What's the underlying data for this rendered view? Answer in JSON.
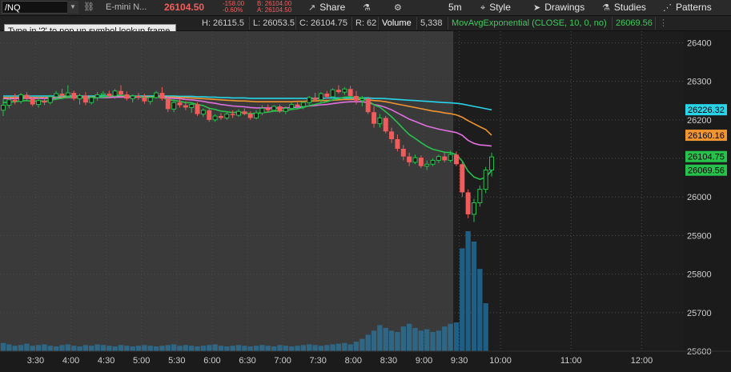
{
  "toolbar": {
    "symbol": "/NQ",
    "description": "E-mini N...",
    "last_price": "26104.50",
    "net_change": "-158.00",
    "pct_change": "-0.60%",
    "bid": "B: 26104.00",
    "ask": "A: 26104.50",
    "share_label": "Share",
    "timeframe": "5m",
    "style_label": "Style",
    "drawings_label": "Drawings",
    "studies_label": "Studies",
    "patterns_label": "Patterns"
  },
  "infobar": {
    "high": "H: 26115.5",
    "low": "L: 26053.5",
    "close": "C: 26104.75",
    "range": "R: 62",
    "volume_label": "Volume",
    "volume_value": "5,338",
    "study": "MovAvgExponential (CLOSE, 10, 0, no)",
    "study_value": "26069.56"
  },
  "tooltip": "Type in '?' to pop up symbol lookup frame.",
  "colors": {
    "up": "#27c24c",
    "down": "#f05b5b",
    "ema_green": "#27c24c",
    "ema_magenta": "#e070e0",
    "ema_orange": "#f09430",
    "ema_cyan": "#28d4e8",
    "ema_yellow": "#d8d040",
    "volume": "#2f6683",
    "volume_current": "#1f5f86"
  },
  "chart_data": {
    "type": "candlestick",
    "xlabel": "",
    "ylabel": "",
    "ylim": [
      25600,
      26430
    ],
    "y_ticks": [
      25600,
      25700,
      25800,
      25900,
      26000,
      26100,
      26200,
      26300,
      26400
    ],
    "x_ticks": [
      "3:30",
      "4:00",
      "4:30",
      "5:00",
      "5:30",
      "6:00",
      "6:30",
      "7:00",
      "7:30",
      "8:00",
      "8:30",
      "9:00",
      "9:30",
      "10:00",
      "11:00",
      "12:00"
    ],
    "x_tick_bars": [
      5.5,
      11.5,
      17.5,
      23.5,
      29.5,
      35.5,
      41.5,
      47.5,
      53.5,
      59.5,
      65.5,
      71.5,
      77.5,
      84.5,
      96.5,
      108.5
    ],
    "bar_count_visible": 114,
    "session_start_bar": 77,
    "candles": [
      [
        26225,
        26255,
        26210,
        26238
      ],
      [
        26238,
        26260,
        26230,
        26252
      ],
      [
        26252,
        26268,
        26240,
        26248
      ],
      [
        26248,
        26270,
        26242,
        26265
      ],
      [
        26265,
        26272,
        26250,
        26255
      ],
      [
        26255,
        26260,
        26235,
        26240
      ],
      [
        26240,
        26258,
        26232,
        26250
      ],
      [
        26250,
        26262,
        26238,
        26245
      ],
      [
        26245,
        26265,
        26240,
        26260
      ],
      [
        26260,
        26275,
        26252,
        26268
      ],
      [
        26268,
        26280,
        26256,
        26262
      ],
      [
        26262,
        26290,
        26258,
        26270
      ],
      [
        26270,
        26276,
        26250,
        26255
      ],
      [
        26255,
        26268,
        26240,
        26263
      ],
      [
        26263,
        26272,
        26238,
        26245
      ],
      [
        26245,
        26262,
        26240,
        26258
      ],
      [
        26258,
        26272,
        26250,
        26265
      ],
      [
        26265,
        26275,
        26255,
        26268
      ],
      [
        26268,
        26276,
        26258,
        26262
      ],
      [
        26262,
        26280,
        26255,
        26275
      ],
      [
        26275,
        26290,
        26260,
        26266
      ],
      [
        26266,
        26274,
        26250,
        26255
      ],
      [
        26255,
        26266,
        26245,
        26262
      ],
      [
        26262,
        26270,
        26252,
        26258
      ],
      [
        26258,
        26268,
        26242,
        26248
      ],
      [
        26248,
        26262,
        26240,
        26258
      ],
      [
        26258,
        26275,
        26255,
        26270
      ],
      [
        26270,
        26285,
        26250,
        26255
      ],
      [
        26255,
        26260,
        26220,
        26228
      ],
      [
        26228,
        26250,
        26220,
        26245
      ],
      [
        26245,
        26255,
        26232,
        26238
      ],
      [
        26238,
        26248,
        26225,
        26232
      ],
      [
        26232,
        26245,
        26218,
        26240
      ],
      [
        26240,
        26246,
        26210,
        26215
      ],
      [
        26215,
        26230,
        26208,
        26225
      ],
      [
        26225,
        26232,
        26195,
        26200
      ],
      [
        26200,
        26215,
        26195,
        26210
      ],
      [
        26210,
        26218,
        26200,
        26205
      ],
      [
        26205,
        26220,
        26200,
        26215
      ],
      [
        26215,
        26225,
        26205,
        26212
      ],
      [
        26212,
        26228,
        26208,
        26222
      ],
      [
        26222,
        26230,
        26212,
        26215
      ],
      [
        26215,
        26222,
        26200,
        26205
      ],
      [
        26205,
        26225,
        26202,
        26218
      ],
      [
        26218,
        26238,
        26212,
        26230
      ],
      [
        26230,
        26240,
        26220,
        26225
      ],
      [
        26225,
        26238,
        26222,
        26235
      ],
      [
        26235,
        26240,
        26218,
        26222
      ],
      [
        26222,
        26235,
        26215,
        26230
      ],
      [
        26230,
        26245,
        26225,
        26240
      ],
      [
        26240,
        26250,
        26230,
        26235
      ],
      [
        26235,
        26248,
        26228,
        26245
      ],
      [
        26245,
        26262,
        26240,
        26258
      ],
      [
        26258,
        26270,
        26248,
        26252
      ],
      [
        26252,
        26272,
        26245,
        26268
      ],
      [
        26268,
        26275,
        26255,
        26260
      ],
      [
        26260,
        26282,
        26255,
        26278
      ],
      [
        26278,
        26290,
        26268,
        26272
      ],
      [
        26272,
        26285,
        26265,
        26280
      ],
      [
        26280,
        26288,
        26258,
        26262
      ],
      [
        26262,
        26275,
        26240,
        26250
      ],
      [
        26250,
        26262,
        26235,
        26255
      ],
      [
        26255,
        26260,
        26215,
        26220
      ],
      [
        26220,
        26235,
        26180,
        26190
      ],
      [
        26190,
        26215,
        26180,
        26205
      ],
      [
        26205,
        26210,
        26165,
        26170
      ],
      [
        26170,
        26180,
        26140,
        26150
      ],
      [
        26150,
        26162,
        26118,
        26125
      ],
      [
        26125,
        26135,
        26095,
        26105
      ],
      [
        26105,
        26115,
        26080,
        26090
      ],
      [
        26090,
        26110,
        26085,
        26102
      ],
      [
        26102,
        26108,
        26075,
        26080
      ],
      [
        26080,
        26095,
        26070,
        26085
      ],
      [
        26085,
        26100,
        26080,
        26095
      ],
      [
        26095,
        26110,
        26088,
        26105
      ],
      [
        26105,
        26115,
        26090,
        26095
      ],
      [
        26095,
        26120,
        26090,
        26110
      ],
      [
        26110,
        26118,
        26080,
        26085
      ],
      [
        26085,
        26090,
        26000,
        26012
      ],
      [
        26012,
        26020,
        25945,
        25955
      ],
      [
        25955,
        25995,
        25935,
        25985
      ],
      [
        25985,
        26030,
        25975,
        26020
      ],
      [
        26020,
        26078,
        26010,
        26070
      ],
      [
        26070,
        26115,
        26053,
        26104
      ]
    ],
    "volume": [
      12,
      10,
      8,
      9,
      11,
      8,
      9,
      10,
      8,
      7,
      9,
      10,
      8,
      7,
      9,
      8,
      10,
      9,
      8,
      7,
      9,
      8,
      7,
      8,
      9,
      8,
      7,
      8,
      9,
      10,
      8,
      9,
      8,
      7,
      8,
      9,
      10,
      8,
      7,
      8,
      9,
      8,
      7,
      8,
      9,
      8,
      7,
      9,
      8,
      7,
      8,
      9,
      10,
      9,
      8,
      9,
      10,
      11,
      12,
      10,
      14,
      18,
      24,
      30,
      38,
      34,
      30,
      28,
      36,
      40,
      34,
      30,
      32,
      28,
      30,
      36,
      40,
      42,
      150,
      175,
      160,
      120,
      70
    ],
    "ema": [
      {
        "period_label": "green",
        "values": [
          26245,
          26246,
          26247,
          26249,
          26250,
          26248,
          26249,
          26248,
          26250,
          26254,
          26256,
          26259,
          26258,
          26259,
          26256,
          26256,
          26258,
          26260,
          26261,
          26264,
          26264,
          26262,
          26262,
          26261,
          26258,
          26258,
          26260,
          26259,
          26252,
          26251,
          26248,
          26245,
          26244,
          26240,
          26237,
          26230,
          26227,
          26223,
          26221,
          26219,
          26220,
          26219,
          26216,
          26216,
          26219,
          26220,
          26223,
          26223,
          26224,
          26227,
          26229,
          26232,
          26237,
          26240,
          26244,
          26247,
          26252,
          26255,
          26259,
          26260,
          26258,
          26257,
          26250,
          26239,
          26233,
          26221,
          26208,
          26193,
          26177,
          26162,
          26152,
          26141,
          26131,
          26124,
          26120,
          26116,
          26115,
          26110,
          26093,
          26067,
          26052,
          26046,
          26051,
          26069
        ]
      },
      {
        "period_label": "magenta",
        "values": [
          26255,
          26255,
          26255,
          26256,
          26256,
          26256,
          26256,
          26256,
          26256,
          26257,
          26257,
          26258,
          26258,
          26258,
          26258,
          26258,
          26258,
          26258,
          26258,
          26259,
          26259,
          26259,
          26259,
          26259,
          26259,
          26259,
          26259,
          26259,
          26257,
          26256,
          26255,
          26253,
          26252,
          26250,
          26248,
          26245,
          26243,
          26240,
          26238,
          26236,
          26235,
          26234,
          26232,
          26231,
          26231,
          26231,
          26231,
          26231,
          26231,
          26232,
          26233,
          26234,
          26236,
          26237,
          26239,
          26240,
          26242,
          26244,
          26246,
          26247,
          26247,
          26247,
          26245,
          26240,
          26237,
          26232,
          26226,
          26218,
          26210,
          26202,
          26196,
          26190,
          26184,
          26180,
          26176,
          26173,
          26170,
          26167,
          26160,
          26147,
          26139,
          26135,
          26134,
          26132
        ]
      },
      {
        "period_label": "orange",
        "values": [
          26258,
          26258,
          26258,
          26258,
          26258,
          26258,
          26258,
          26258,
          26258,
          26258,
          26259,
          26259,
          26259,
          26259,
          26259,
          26259,
          26259,
          26259,
          26259,
          26259,
          26260,
          26260,
          26260,
          26260,
          26260,
          26260,
          26260,
          26260,
          26259,
          26259,
          26258,
          26258,
          26257,
          26256,
          26255,
          26254,
          26253,
          26252,
          26251,
          26250,
          26249,
          26249,
          26248,
          26247,
          26247,
          26247,
          26247,
          26247,
          26247,
          26247,
          26248,
          26248,
          26249,
          26249,
          26250,
          26250,
          26251,
          26252,
          26253,
          26253,
          26253,
          26253,
          26252,
          26250,
          26249,
          26247,
          26244,
          26241,
          26238,
          26235,
          26232,
          26229,
          26226,
          26223,
          26221,
          26218,
          26216,
          26213,
          26207,
          26198,
          26190,
          26182,
          26175,
          26160
        ]
      },
      {
        "period_label": "cyan",
        "values": [
          26262,
          26262,
          26262,
          26262,
          26262,
          26262,
          26262,
          26262,
          26262,
          26262,
          26262,
          26262,
          26262,
          26262,
          26262,
          26262,
          26262,
          26262,
          26262,
          26262,
          26262,
          26262,
          26262,
          26262,
          26262,
          26262,
          26262,
          26262,
          26262,
          26262,
          26261,
          26261,
          26261,
          26260,
          26260,
          26259,
          26259,
          26258,
          26258,
          26257,
          26257,
          26257,
          26256,
          26256,
          26256,
          26256,
          26256,
          26256,
          26256,
          26256,
          26256,
          26256,
          26256,
          26256,
          26256,
          26257,
          26257,
          26257,
          26257,
          26257,
          26257,
          26257,
          26257,
          26256,
          26256,
          26255,
          26254,
          26253,
          26252,
          26251,
          26250,
          26249,
          26248,
          26247,
          26246,
          26245,
          26244,
          26243,
          26241,
          26238,
          26235,
          26232,
          26229,
          26226
        ]
      }
    ],
    "price_labels": [
      {
        "text": "26226.32",
        "color": "#28d4e8"
      },
      {
        "text": "26160.16",
        "color": "#f09430"
      },
      {
        "text": "26104.75",
        "color": "#27c24c"
      },
      {
        "text": "26069.56",
        "color": "#27c24c"
      }
    ]
  }
}
